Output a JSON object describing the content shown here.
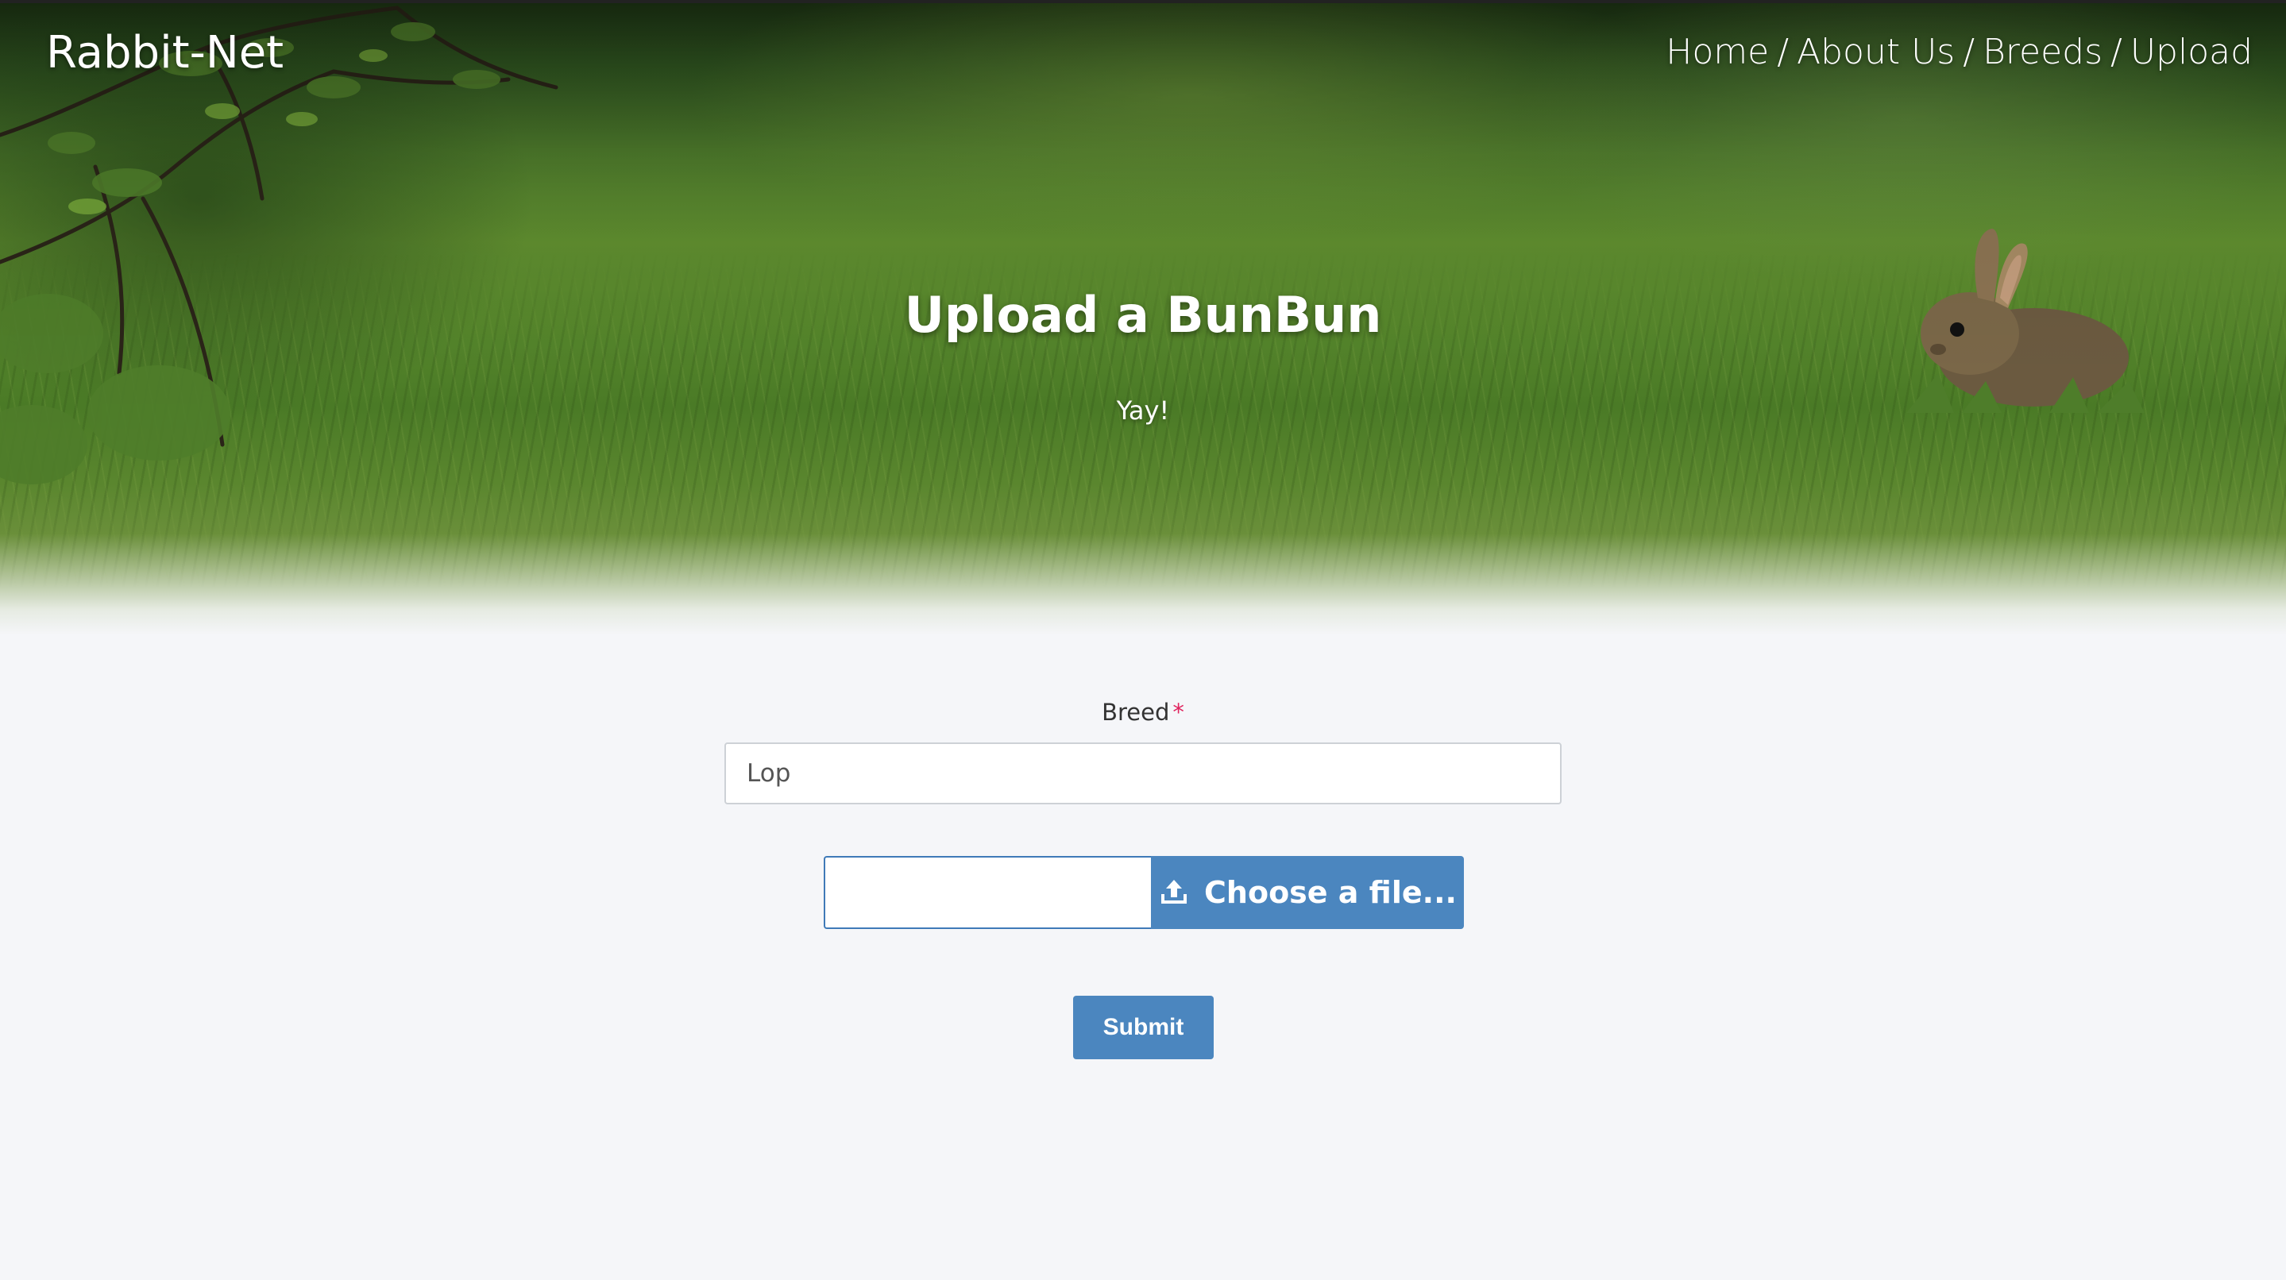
{
  "header": {
    "brand": "Rabbit-Net",
    "nav": [
      {
        "label": "Home"
      },
      {
        "label": "About Us"
      },
      {
        "label": "Breeds"
      },
      {
        "label": "Upload"
      }
    ],
    "nav_separator": "/"
  },
  "hero": {
    "title": "Upload a BunBun",
    "subtitle": "Yay!"
  },
  "form": {
    "breed_label": "Breed",
    "required_mark": "*",
    "breed_value": "Lop",
    "file_button_label": "Choose a file...",
    "submit_label": "Submit"
  },
  "colors": {
    "accent": "#4b86bf",
    "required": "#e0245e",
    "background": "#f5f6f9"
  },
  "icons": {
    "upload": "upload-icon"
  }
}
